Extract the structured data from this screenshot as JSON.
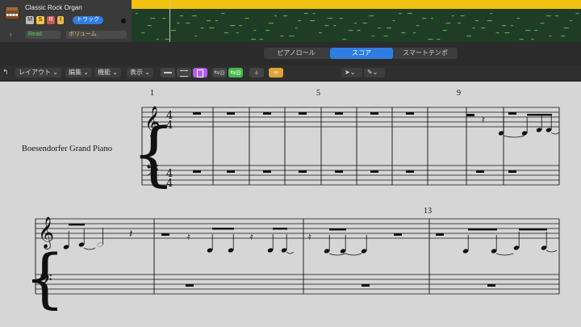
{
  "track": {
    "name": "Classic Rock Organ",
    "buttons": [
      "M",
      "S",
      "R",
      "I"
    ],
    "track_badge": "トラック",
    "read_mode": "Read",
    "automation_param": "ボリューム"
  },
  "colors": {
    "region_yellow": "#f2c211",
    "region_body": "#1f3d25",
    "tab_active": "#2f7de1",
    "mute": "#8ad0f5",
    "solo": "#f5c342",
    "purple": "#b061e6",
    "green": "#46b94f",
    "orange": "#e0a23a"
  },
  "tabs": [
    {
      "label": "ピアノロール",
      "active": false
    },
    {
      "label": "スコア",
      "active": true
    },
    {
      "label": "スマートテンポ",
      "active": false
    }
  ],
  "toolbar": {
    "menus": [
      "レイアウト",
      "編集",
      "機能",
      "表示"
    ],
    "icons": [
      "back-icon",
      "view-linear-icon",
      "view-lines-icon",
      "view-page-icon",
      "midi-in-icon",
      "midi-out-icon",
      "tuner-icon",
      "link-icon",
      "pointer-tool-icon",
      "pencil-tool-icon"
    ]
  },
  "score": {
    "instrument": "Boesendorfer Grand Piano",
    "measure_numbers": [
      "1",
      "5",
      "9",
      "13"
    ],
    "time_signature": "4/4"
  }
}
